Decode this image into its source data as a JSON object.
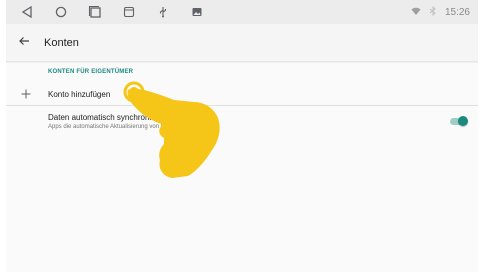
{
  "status_bar": {
    "time": "15:26",
    "icons": [
      "back-triangle-icon",
      "home-circle-icon",
      "recents-square-icon",
      "screenshot-icon",
      "usb-icon",
      "image-icon",
      "wifi-icon",
      "bluetooth-icon"
    ]
  },
  "app_bar": {
    "title": "Konten",
    "back_icon": "arrow-left-icon"
  },
  "section": {
    "header": "KONTEN FÜR EIGENTÜMER"
  },
  "add_account": {
    "label": "Konto hinzufügen",
    "icon": "plus-icon"
  },
  "sync_setting": {
    "title": "Daten automatisch synchronisieren",
    "subtitle": "Apps die automatische Aktualisierung von Daten erlauben",
    "enabled": true
  },
  "colors": {
    "accent": "#1a8a7d",
    "hand": "#f5c518"
  }
}
